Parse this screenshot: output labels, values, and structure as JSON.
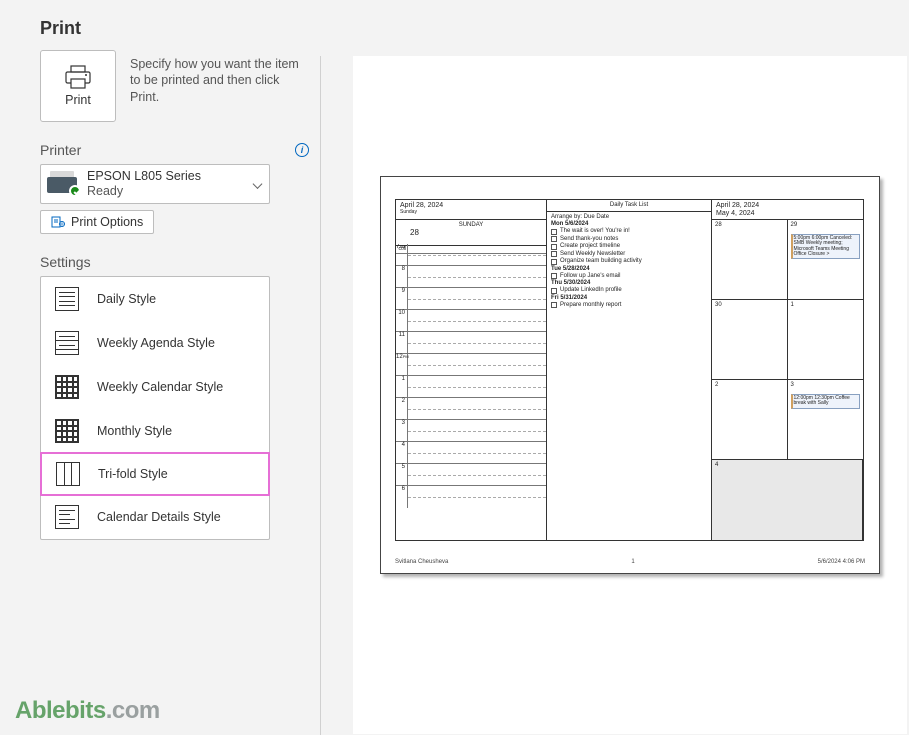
{
  "page_title": "Print",
  "description": "Specify how you want the item to be printed and then click Print.",
  "print_button_label": "Print",
  "printer_section": "Printer",
  "printer": {
    "name": "EPSON L805 Series",
    "status": "Ready"
  },
  "print_options_label": "Print Options",
  "settings_section": "Settings",
  "styles": [
    {
      "label": "Daily Style"
    },
    {
      "label": "Weekly Agenda Style"
    },
    {
      "label": "Weekly Calendar Style"
    },
    {
      "label": "Monthly Style"
    },
    {
      "label": "Tri-fold Style"
    },
    {
      "label": "Calendar Details Style"
    }
  ],
  "preview": {
    "col1": {
      "date_title": "April 28, 2024",
      "subtitle": "Sunday",
      "day_label": "SUNDAY",
      "day_number": "28",
      "pre_label": "coll",
      "hours": [
        "7",
        "8",
        "9",
        "10",
        "11",
        "12",
        "1",
        "2",
        "3",
        "4",
        "5",
        "6"
      ],
      "hours_suffix": [
        "AM",
        "",
        "",
        "",
        "",
        "PM",
        "",
        "",
        "",
        "",
        "",
        ""
      ]
    },
    "col2": {
      "title": "Daily Task List",
      "arrange": "Arrange by: Due Date",
      "groups": [
        {
          "header": "Mon 5/6/2024",
          "tasks": [
            "The wait is over! You're in!",
            "Send thank-you notes",
            "Create project timeline",
            "Send Weekly Newsletter",
            "Organize team building activity"
          ]
        },
        {
          "header": "Tue 5/28/2024",
          "tasks": [
            "Follow up Jane's email"
          ]
        },
        {
          "header": "Thu 5/30/2024",
          "tasks": [
            "Update LinkedIn profile"
          ]
        },
        {
          "header": "Fri 5/31/2024",
          "tasks": [
            "Prepare monthly report"
          ]
        }
      ]
    },
    "col3": {
      "range_a": "April 28, 2024",
      "range_b": "May 4, 2024",
      "cells": [
        {
          "num": "28"
        },
        {
          "num": "29",
          "ev": "5:00pm 6:00pm Canceled: SMB Weekly meeting; Microsoft Teams Meeting   Office Closure &gt;"
        },
        {
          "num": "30"
        },
        {
          "num": "1"
        },
        {
          "num": "2"
        },
        {
          "num": "3",
          "ev": "12:00pm 12:30pm Coffee break with Sally"
        },
        {
          "num": "4",
          "shade": true,
          "span": true
        },
        {
          "num": ""
        }
      ]
    },
    "footer_left": "Svitlana Cheusheva",
    "footer_center": "1",
    "footer_right": "5/6/2024 4:06 PM"
  },
  "watermark_a": "Ablebits",
  "watermark_b": ".com"
}
